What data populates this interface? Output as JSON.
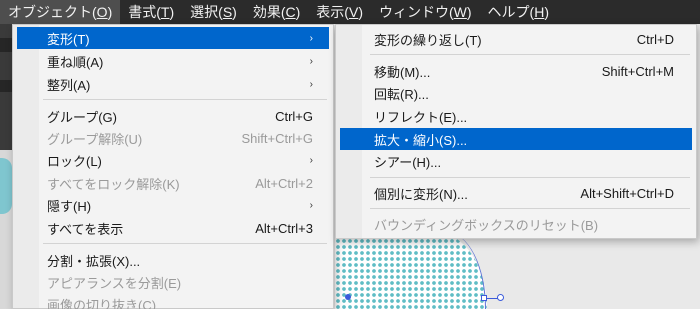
{
  "menubar": {
    "items": [
      {
        "label": "オブジェクト(",
        "acc": "O",
        "end": ")"
      },
      {
        "label": "書式(",
        "acc": "T",
        "end": ")"
      },
      {
        "label": "選択(",
        "acc": "S",
        "end": ")"
      },
      {
        "label": "効果(",
        "acc": "C",
        "end": ")"
      },
      {
        "label": "表示(",
        "acc": "V",
        "end": ")"
      },
      {
        "label": "ウィンドウ(",
        "acc": "W",
        "end": ")"
      },
      {
        "label": "ヘルプ(",
        "acc": "H",
        "end": ")"
      }
    ]
  },
  "object_menu": {
    "items": [
      {
        "label": "変形(T)",
        "shortcut": "",
        "arrow": "›"
      },
      {
        "label": "重ね順(A)",
        "shortcut": "",
        "arrow": "›"
      },
      {
        "label": "整列(A)",
        "shortcut": "",
        "arrow": "›"
      },
      {
        "label": "グループ(G)",
        "shortcut": "Ctrl+G",
        "arrow": ""
      },
      {
        "label": "グループ解除(U)",
        "shortcut": "Shift+Ctrl+G",
        "arrow": ""
      },
      {
        "label": "ロック(L)",
        "shortcut": "",
        "arrow": "›"
      },
      {
        "label": "すべてをロック解除(K)",
        "shortcut": "Alt+Ctrl+2",
        "arrow": ""
      },
      {
        "label": "隠す(H)",
        "shortcut": "",
        "arrow": "›"
      },
      {
        "label": "すべてを表示",
        "shortcut": "Alt+Ctrl+3",
        "arrow": ""
      },
      {
        "label": "分割・拡張(X)...",
        "shortcut": "",
        "arrow": ""
      },
      {
        "label": "アピアランスを分割(E)",
        "shortcut": "",
        "arrow": ""
      },
      {
        "label": "画像の切り抜き(C)",
        "shortcut": "",
        "arrow": ""
      }
    ]
  },
  "transform_submenu": {
    "items": [
      {
        "label": "変形の繰り返し(T)",
        "shortcut": "Ctrl+D"
      },
      {
        "label": "移動(M)...",
        "shortcut": "Shift+Ctrl+M"
      },
      {
        "label": "回転(R)...",
        "shortcut": ""
      },
      {
        "label": "リフレクト(E)...",
        "shortcut": ""
      },
      {
        "label": "拡大・縮小(S)...",
        "shortcut": ""
      },
      {
        "label": "シアー(H)...",
        "shortcut": ""
      },
      {
        "label": "個別に変形(N)...",
        "shortcut": "Alt+Shift+Ctrl+D"
      },
      {
        "label": "バウンディングボックスのリセット(B)",
        "shortcut": ""
      }
    ]
  },
  "colors": {
    "menubar_bg": "#2b2b2b",
    "highlight": "#0066cc",
    "menu_bg": "#f3f3f3",
    "disabled_text": "#9a9a9a",
    "pattern_teal": "#5fbdc5"
  }
}
